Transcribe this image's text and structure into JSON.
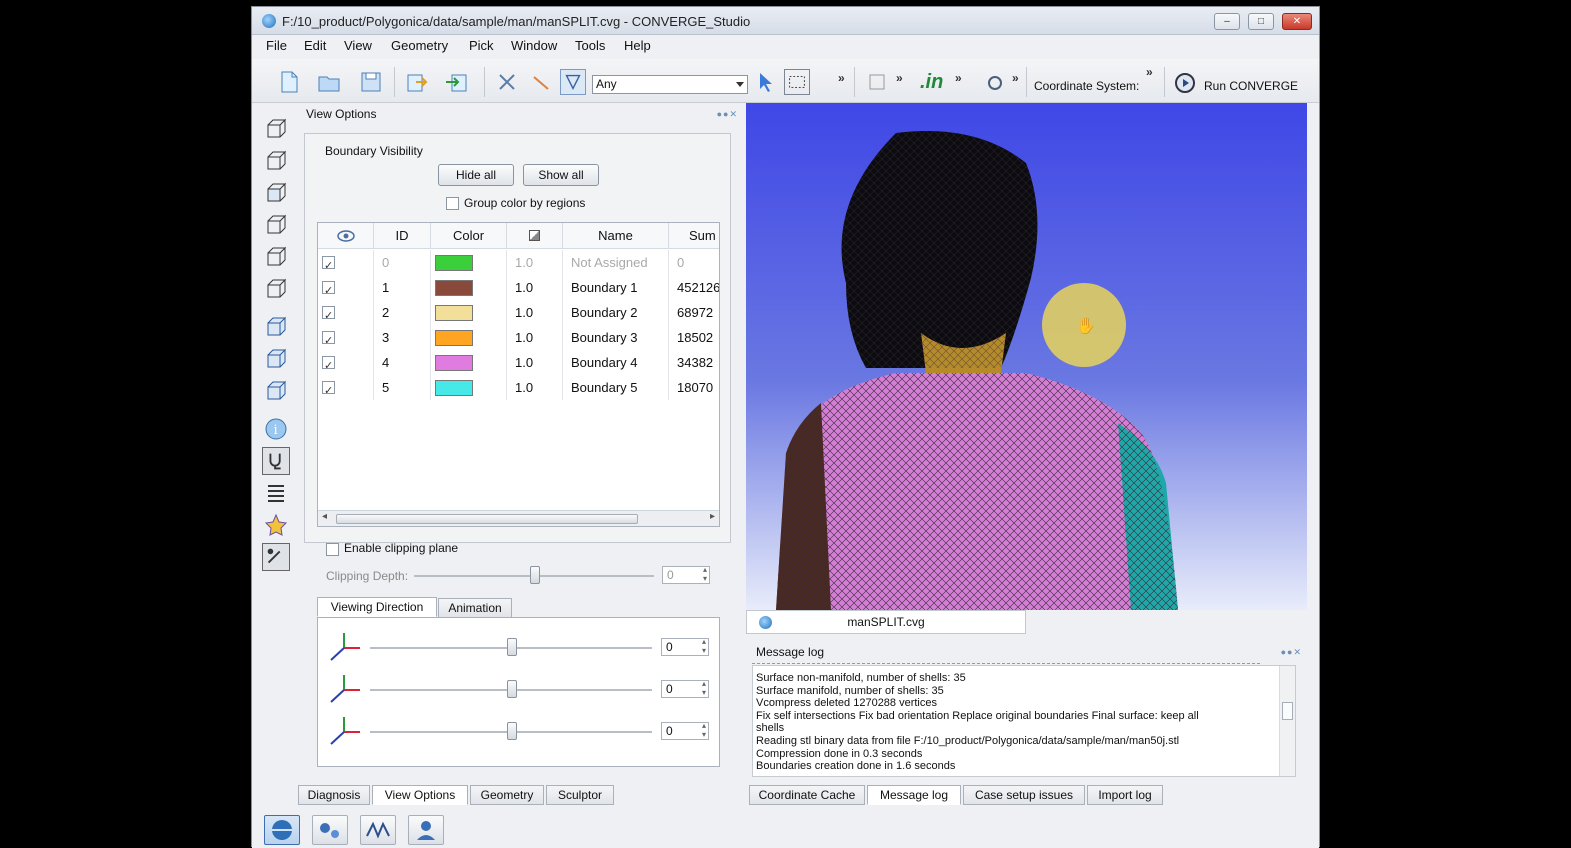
{
  "window": {
    "title": "F:/10_product/Polygonica/data/sample/man/manSPLIT.cvg - CONVERGE_Studio",
    "minimize": "–",
    "maximize": "□",
    "close": "✕"
  },
  "menu": [
    "File",
    "Edit",
    "View",
    "Geometry",
    "Pick",
    "Window",
    "Tools",
    "Help"
  ],
  "toolbar": {
    "pick_filter_value": "Any",
    "in_label": ".in",
    "coordinate_system_label": "Coordinate System:",
    "run_label": "Run CONVERGE",
    "more": "»"
  },
  "view_options": {
    "title": "View Options",
    "panel_controls": "●●✕",
    "boundary_visibility_label": "Boundary Visibility",
    "hide_all_label": "Hide all",
    "show_all_label": "Show all",
    "group_color_label": "Group color by regions",
    "columns": {
      "id": "ID",
      "color": "Color",
      "name": "Name",
      "sum": "Sum"
    },
    "rows": [
      {
        "checked": true,
        "id": "0",
        "color": "#3ccf3c",
        "opacity": "1.0",
        "name": "Not Assigned",
        "sum": "0"
      },
      {
        "checked": true,
        "id": "1",
        "color": "#8a4a3b",
        "opacity": "1.0",
        "name": "Boundary 1",
        "sum": "452126"
      },
      {
        "checked": true,
        "id": "2",
        "color": "#f2df9a",
        "opacity": "1.0",
        "name": "Boundary 2",
        "sum": "68972"
      },
      {
        "checked": true,
        "id": "3",
        "color": "#ffa521",
        "opacity": "1.0",
        "name": "Boundary 3",
        "sum": "18502"
      },
      {
        "checked": true,
        "id": "4",
        "color": "#e07be0",
        "opacity": "1.0",
        "name": "Boundary 4",
        "sum": "34382"
      },
      {
        "checked": true,
        "id": "5",
        "color": "#46e8e8",
        "opacity": "1.0",
        "name": "Boundary 5",
        "sum": "18070"
      }
    ],
    "enable_clipping_label": "Enable clipping plane",
    "clipping_depth_label": "Clipping Depth:",
    "clipping_depth_value": "0",
    "tabs": {
      "viewing_direction": "Viewing Direction",
      "animation": "Animation"
    },
    "axis_values": [
      "0",
      "0",
      "0"
    ]
  },
  "left_tabs": [
    "Diagnosis",
    "View Options",
    "Geometry",
    "Sculptor"
  ],
  "viewport_tab": "manSPLIT.cvg",
  "message_log": {
    "title": "Message log",
    "lines": [
      "Surface non-manifold, number of shells: 35",
      "Surface manifold, number of shells: 35",
      "Vcompress deleted 1270288 vertices",
      "Fix self intersections Fix bad orientation Replace original boundaries  Final surface: keep all",
      "shells",
      "Reading stl binary data from file F:/10_product/Polygonica/data/sample/man/man50j.stl",
      "Compression done in 0.3 seconds",
      "Boundaries creation done in 1.6 seconds"
    ]
  },
  "bottom_tabs": [
    "Coordinate Cache",
    "Message log",
    "Case setup issues",
    "Import log"
  ]
}
